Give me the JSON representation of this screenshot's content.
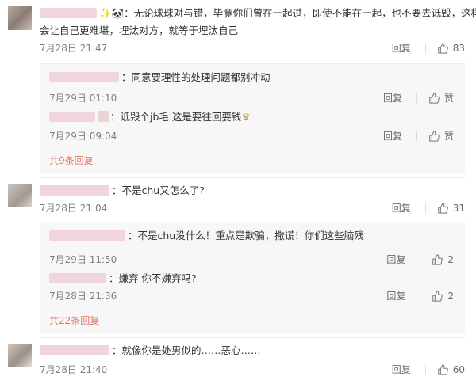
{
  "comments": [
    {
      "text": "无论球球对与错，毕竟你们曾在一起过，即使不能在一起，也不要去诋毁，这样只",
      "text2": "会让自己更难堪，埋汰对方，就等于埋汰自己",
      "time": "7月28日 21:47",
      "reply": "回复",
      "likes": "83",
      "subs": [
        {
          "text": "同意要理性的处理问题都别冲动",
          "time": "7月29日 01:10",
          "reply": "回复",
          "likes": "赞"
        },
        {
          "text": "诋毁个jb毛 这是要往回要钱",
          "time": "7月29日 09:04",
          "reply": "回复",
          "likes": "赞"
        }
      ],
      "more": "共9条回复"
    },
    {
      "text": "不是chu又怎么了?",
      "time": "7月28日 21:04",
      "reply": "回复",
      "likes": "31",
      "subs": [
        {
          "text": "不是chu没什么！重点是欺骗，撒谎！你们这些脑残",
          "time": "7月29日 11:50",
          "reply": "回复",
          "likes": "2"
        },
        {
          "text": "嫌弃 你不嫌弃吗?",
          "time": "7月28日 21:36",
          "reply": "回复",
          "likes": "2"
        }
      ],
      "more": "共22条回复"
    },
    {
      "text": "就像你是处男似的……恶心……",
      "time": "7月28日 21:40",
      "reply": "回复",
      "likes": "60"
    }
  ]
}
